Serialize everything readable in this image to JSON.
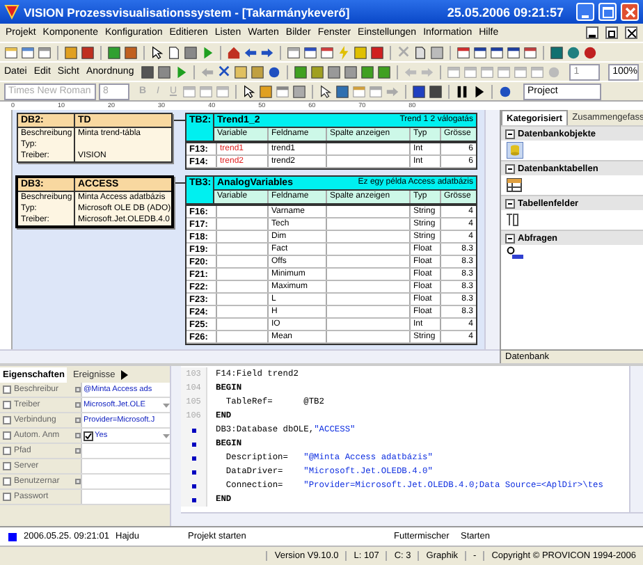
{
  "window": {
    "title": "VISION Prozessvisualisationssystem - [Takarmánykeverő]",
    "clock": "25.05.2006 09:21:57"
  },
  "menu": [
    "Projekt",
    "Komponente",
    "Konfiguration",
    "Editieren",
    "Listen",
    "Warten",
    "Bilder",
    "Fenster",
    "Einstellungen",
    "Information",
    "Hilfe"
  ],
  "edit_toolbar": {
    "menus": [
      "Datei",
      "Edit",
      "Sicht",
      "Anordnung"
    ],
    "spin_value": "1",
    "zoom": "100%"
  },
  "format_toolbar": {
    "font": "Times New Roman",
    "size": "8",
    "disabled": true,
    "style_buttons": [
      "B",
      "I",
      "U"
    ],
    "project": "Project"
  },
  "ruler": [
    "0",
    "10",
    "20",
    "30",
    "40",
    "50",
    "60",
    "70",
    "80"
  ],
  "databases": [
    {
      "id": "DB2:",
      "name": "TD",
      "selected": false,
      "fields": [
        {
          "label": "Beschreibung",
          "value": "Minta trend-tábla"
        },
        {
          "label": "Typ:"
        },
        {
          "label": "Treiber:",
          "value": "VISION"
        }
      ]
    },
    {
      "id": "DB3:",
      "name": "ACCESS",
      "selected": true,
      "fields": [
        {
          "label": "Beschreibung",
          "value": "Minta Access adatbázis"
        },
        {
          "label": "Typ:",
          "value": "Microsoft OLE DB (ADO)"
        },
        {
          "label": "Treiber:",
          "value": "Microsoft.Jet.OLEDB.4.0"
        }
      ]
    }
  ],
  "tables": [
    {
      "id": "TB2:",
      "name": "Trend1_2",
      "comment": "Trend 1 2 válogatás",
      "columns": [
        "Variable",
        "Feldname",
        "Spalte anzeigen",
        "Typ",
        "Grösse"
      ],
      "rows": [
        {
          "id": "F13:",
          "variable": "trend1",
          "field": "trend1",
          "type": "Int",
          "size": "6"
        },
        {
          "id": "F14:",
          "variable": "trend2",
          "field": "trend2",
          "type": "Int",
          "size": "6"
        }
      ]
    },
    {
      "id": "TB3:",
      "name": "AnalogVariables",
      "comment": "Ez egy példa Access adatbázis",
      "columns": [
        "Variable",
        "Feldname",
        "Spalte anzeigen",
        "Typ",
        "Grösse"
      ],
      "rows": [
        {
          "id": "F16:",
          "field": "Varname",
          "type": "String",
          "size": "4"
        },
        {
          "id": "F17:",
          "field": "Tech",
          "type": "String",
          "size": "4"
        },
        {
          "id": "F18:",
          "field": "Dim",
          "type": "String",
          "size": "4"
        },
        {
          "id": "F19:",
          "field": "Fact",
          "type": "Float",
          "size": "8.3"
        },
        {
          "id": "F20:",
          "field": "Offs",
          "type": "Float",
          "size": "8.3"
        },
        {
          "id": "F21:",
          "field": "Minimum",
          "type": "Float",
          "size": "8.3"
        },
        {
          "id": "F22:",
          "field": "Maximum",
          "type": "Float",
          "size": "8.3"
        },
        {
          "id": "F23:",
          "field": "L",
          "type": "Float",
          "size": "8.3"
        },
        {
          "id": "F24:",
          "field": "H",
          "type": "Float",
          "size": "8.3"
        },
        {
          "id": "F25:",
          "field": "IO",
          "type": "Int",
          "size": "4"
        },
        {
          "id": "F26:",
          "field": "Mean",
          "type": "String",
          "size": "4"
        }
      ]
    }
  ],
  "object_panel": {
    "tabs": [
      {
        "label": "Kategorisiert",
        "selected": true
      },
      {
        "label": "Zusammengefass",
        "selected": false
      }
    ],
    "sections": [
      {
        "title": "Datenbankobjekte",
        "expanded": true,
        "kind": "database"
      },
      {
        "title": "Datenbanktabellen",
        "expanded": true,
        "kind": "table"
      },
      {
        "title": "Tabellenfelder",
        "expanded": true,
        "kind": "field"
      },
      {
        "title": "Abfragen",
        "expanded": true,
        "kind": "query"
      }
    ],
    "footer": "Datenbank"
  },
  "properties": {
    "tabs": [
      {
        "label": "Eigenschaften",
        "selected": true
      },
      {
        "label": "Ereignisse",
        "selected": false
      }
    ],
    "rows": [
      {
        "name": "Beschreibur",
        "dots": true,
        "kind": "text",
        "value": "@Minta Access ads"
      },
      {
        "name": "Treiber",
        "dots": true,
        "kind": "dropdown",
        "value": "Microsoft.Jet.OLE"
      },
      {
        "name": "Verbindung",
        "dots": true,
        "kind": "text",
        "value": "Provider=Microsoft.J"
      },
      {
        "name": "Autom. Anm",
        "dots": true,
        "kind": "checkbox",
        "checked": true,
        "value": "Yes"
      },
      {
        "name": "Pfad",
        "dots": true,
        "kind": "text"
      },
      {
        "name": "Server",
        "dots": false,
        "kind": "text"
      },
      {
        "name": "Benutzernar",
        "dots": true,
        "kind": "text"
      },
      {
        "name": "Passwort",
        "dots": false,
        "kind": "text"
      }
    ]
  },
  "code": [
    {
      "number": "103",
      "segments": [
        {
          "kind": "plain",
          "text": "F14:Field trend2"
        }
      ]
    },
    {
      "number": "104",
      "segments": [
        {
          "kind": "keyword",
          "text": "BEGIN"
        }
      ]
    },
    {
      "number": "105",
      "segments": [
        {
          "kind": "plain",
          "text": "  TableRef=      @TB2"
        }
      ]
    },
    {
      "number": "106",
      "segments": [
        {
          "kind": "keyword",
          "text": "END"
        }
      ]
    },
    {
      "segments": [
        {
          "kind": "plain",
          "text": "DB3:Database dbOLE,"
        },
        {
          "kind": "string",
          "text": "\"ACCESS\""
        }
      ]
    },
    {
      "segments": [
        {
          "kind": "keyword",
          "text": "BEGIN"
        }
      ]
    },
    {
      "segments": [
        {
          "kind": "plain",
          "text": "  Description=   "
        },
        {
          "kind": "string",
          "text": "\"@Minta Access adatbázis\""
        }
      ]
    },
    {
      "segments": [
        {
          "kind": "plain",
          "text": "  DataDriver=    "
        },
        {
          "kind": "string",
          "text": "\"Microsoft.Jet.OLEDB.4.0\""
        }
      ]
    },
    {
      "segments": [
        {
          "kind": "plain",
          "text": "  Connection=    "
        },
        {
          "kind": "string",
          "text": "\"Provider=Microsoft.Jet.OLEDB.4.0;Data Source=<AplDir>\\tes"
        }
      ]
    },
    {
      "segments": [
        {
          "kind": "keyword",
          "text": "END"
        }
      ]
    }
  ],
  "log": {
    "color": "#0000ff",
    "time": "2006.05.25. 09:21:01",
    "user": "Hajdu",
    "action": "Projekt starten",
    "object": "Futtermischer",
    "command": "Starten"
  },
  "status_bar": [
    "Version V9.10.0",
    "L: 107",
    "C: 3",
    "Graphik",
    "-",
    "Copyright © PROVICON 1994-2006"
  ]
}
